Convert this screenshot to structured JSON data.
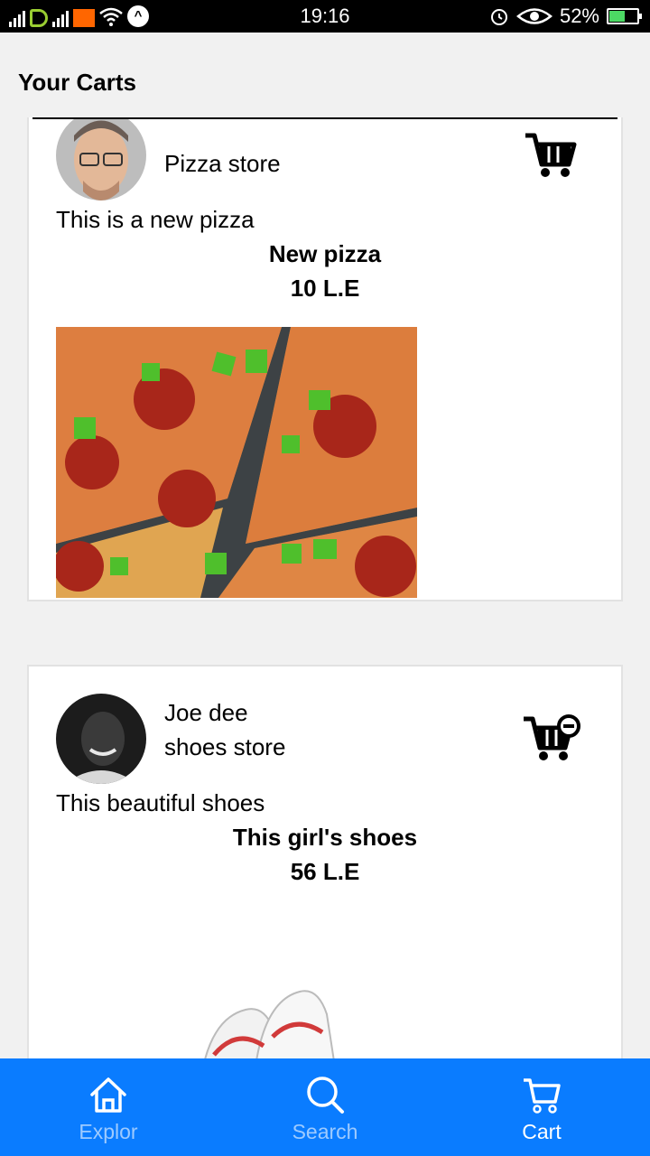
{
  "status_bar": {
    "time": "19:16",
    "battery_percent": "52%",
    "battery_level": 0.52,
    "icons": [
      "signal-icon",
      "carrier-icon",
      "signal-icon",
      "carrier-orange-icon",
      "wifi-icon",
      "notification-icon",
      "alarm-icon",
      "eye-icon",
      "battery-icon"
    ]
  },
  "header": {
    "title": "Your Carts"
  },
  "carts": [
    {
      "seller": "",
      "store": "Pizza store",
      "description": "This is a new pizza",
      "product_name": "New pizza",
      "price": "10 L.E",
      "cart_icon": "cart-icon"
    },
    {
      "seller": "Joe dee",
      "store": "shoes store",
      "description": "This beautiful shoes",
      "product_name": "This girl's shoes",
      "price": "56 L.E",
      "cart_icon": "cart-remove-icon"
    }
  ],
  "bottom_nav": {
    "items": [
      {
        "label": "Explor",
        "icon": "home-icon",
        "active": false
      },
      {
        "label": "Search",
        "icon": "search-icon",
        "active": false
      },
      {
        "label": "Cart",
        "icon": "cart-icon",
        "active": true
      }
    ]
  },
  "colors": {
    "nav_background": "#0a7cff",
    "page_background": "#f1f1f1",
    "card_background": "#ffffff"
  }
}
